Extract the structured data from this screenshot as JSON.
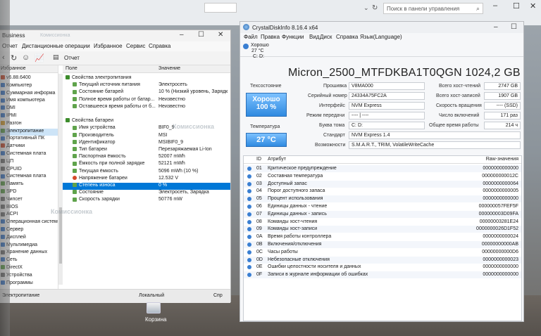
{
  "background_window": {
    "search_placeholder": "Поиск в панели управления"
  },
  "aida": {
    "title": "Business",
    "watermark": "Комиссионка",
    "menu": [
      "Отчет",
      "Дистанционные операции",
      "Избранное",
      "Сервис",
      "Справка"
    ],
    "toolbar_report": "Отчет",
    "left_header": "Избранное",
    "tree": [
      {
        "label": "v6.88.6400",
        "color": "#d04a2a"
      },
      {
        "label": "Компьютер",
        "color": "#3b7bd0"
      },
      {
        "label": "Суммарная информа",
        "color": "#3b7bd0"
      },
      {
        "label": "Имя компьютера",
        "color": "#3b7bd0"
      },
      {
        "label": "DMI",
        "color": "#3b7bd0"
      },
      {
        "label": "IPMI",
        "color": "#3b7bd0"
      },
      {
        "label": "Разгон",
        "color": "#e0a22a"
      },
      {
        "label": "Электропитание",
        "color": "#5fa34b",
        "selected": true
      },
      {
        "label": "Портативный ПК",
        "color": "#3b7bd0"
      },
      {
        "label": "Датчики",
        "color": "#d04a2a"
      },
      {
        "label": "Системная плата",
        "color": "#3b7bd0"
      },
      {
        "label": "ЦП",
        "color": "#777"
      },
      {
        "label": "CPUID",
        "color": "#777"
      },
      {
        "label": "Системная плата",
        "color": "#3b7bd0"
      },
      {
        "label": "Память",
        "color": "#5fa34b"
      },
      {
        "label": "SPD",
        "color": "#5fa34b"
      },
      {
        "label": "Чипсет",
        "color": "#777"
      },
      {
        "label": "BIOS",
        "color": "#777"
      },
      {
        "label": "ACPI",
        "color": "#777"
      },
      {
        "label": "Операционная система",
        "color": "#3b7bd0"
      },
      {
        "label": "Сервер",
        "color": "#3b7bd0"
      },
      {
        "label": "Дисплей",
        "color": "#3b7bd0"
      },
      {
        "label": "Мультимедиа",
        "color": "#3b7bd0"
      },
      {
        "label": "Хранение данных",
        "color": "#777"
      },
      {
        "label": "Сеть",
        "color": "#3b7bd0"
      },
      {
        "label": "DirectX",
        "color": "#5fa34b"
      },
      {
        "label": "Устройства",
        "color": "#777"
      },
      {
        "label": "Программы",
        "color": "#3b7bd0"
      }
    ],
    "col_field": "Поле",
    "col_value": "Значение",
    "rows": [
      {
        "field": "Свойства электропитания",
        "value": "",
        "level": 0
      },
      {
        "field": "Текущий источник питания",
        "value": "Электросеть",
        "level": 1
      },
      {
        "field": "Состояние батарей",
        "value": "10 % (Низкий уровень, Зарядк",
        "level": 1
      },
      {
        "field": "Полное время работы от батар...",
        "value": "Неизвестно",
        "level": 1
      },
      {
        "field": "Оставшееся время работы от б...",
        "value": "Неизвестно",
        "level": 1
      },
      {
        "field": "",
        "value": "",
        "level": 1
      },
      {
        "field": "Свойства батареи",
        "value": "",
        "level": 0
      },
      {
        "field": "Имя устройства",
        "value": "BIF0_9",
        "level": 1
      },
      {
        "field": "Производитель",
        "value": "MSI",
        "level": 1
      },
      {
        "field": "Идентификатор",
        "value": "MSIBIF0_9",
        "level": 1
      },
      {
        "field": "Тип батареи",
        "value": "Перезаряжаемая Li-Ion",
        "level": 1
      },
      {
        "field": "Паспортная ёмкость",
        "value": "52007 mWh",
        "level": 1
      },
      {
        "field": "Ёмкость при полной зарядке",
        "value": "52121 mWh",
        "level": 1
      },
      {
        "field": "Текущая ёмкость",
        "value": "5096 mWh  (10 %)",
        "level": 1
      },
      {
        "field": "Напряжение батареи",
        "value": "12.532 V",
        "level": 1,
        "warn": true
      },
      {
        "field": "Степень износа",
        "value": "0 %",
        "level": 1,
        "selected": true
      },
      {
        "field": "Состояние",
        "value": "Электросеть, Зарядка",
        "level": 1
      },
      {
        "field": "Скорость зарядки",
        "value": "50776 mW",
        "level": 1
      }
    ],
    "status_left": "Электропитание",
    "status_mid": "Локальный",
    "status_right": "Спр"
  },
  "desktop": {
    "trash_label": "Корзина"
  },
  "cdi": {
    "title": "CrystalDiskInfo 8.16.4 x64",
    "menu": [
      "Файл",
      "Правка",
      "Функции",
      "Вид",
      "Диск",
      "Справка",
      "Язык(Language)"
    ],
    "drive_status": "Хорошо",
    "drive_temp": "27 °C",
    "drive_letter": "C: D:",
    "model": "Micron_2500_MTFDKBA1T0QGN 1024,2 GB",
    "tech_state_label": "Техсостояние",
    "health_word": "Хорошо",
    "health_pct": "100 %",
    "temp_label": "Температура",
    "temp_value": "27 °C",
    "fields": {
      "firmware_label": "Прошивка",
      "firmware": "V8MA000",
      "serial_label": "Серийный номер",
      "serial": "24334A75FC2A",
      "interface_label": "Интерфейс",
      "interface": "NVM Express",
      "transfer_label": "Режим передачи",
      "transfer": "---- | ----",
      "letter_label": "Буква тома",
      "letter": "C: D:",
      "standard_label": "Стандарт",
      "standard": "NVM Express 1.4",
      "features_label": "Возможности",
      "features": "S.M.A.R.T., TRIM, VolatileWriteCache",
      "host_reads_label": "Всего хост-чтений",
      "host_reads": "2747 GB",
      "host_writes_label": "Всего хост-записей",
      "host_writes": "1907 GB",
      "rotation_label": "Скорость вращения",
      "rotation": "---- (SSD)",
      "power_on_label": "Число включений",
      "power_on": "171 раз",
      "hours_label": "Общее время работы",
      "hours": "214 ч"
    },
    "smart_hdr": {
      "id": "ID",
      "attr": "Атрибут",
      "raw": "Raw-значения"
    },
    "smart": [
      {
        "id": "01",
        "name": "Критическое предупреждение",
        "raw": "0000000000000"
      },
      {
        "id": "02",
        "name": "Составная температура",
        "raw": "000000000012C"
      },
      {
        "id": "03",
        "name": "Доступный запас",
        "raw": "0000000000064"
      },
      {
        "id": "04",
        "name": "Порог доступного запаса",
        "raw": "0000000000005"
      },
      {
        "id": "05",
        "name": "Процент использования",
        "raw": "0000000000000"
      },
      {
        "id": "06",
        "name": "Единицы данных - чтение",
        "raw": "000000057FEF5F"
      },
      {
        "id": "07",
        "name": "Единицы данных - запись",
        "raw": "000000003D09FA"
      },
      {
        "id": "08",
        "name": "Команды хост-чтения",
        "raw": "00000003281E24"
      },
      {
        "id": "09",
        "name": "Команды хост-записи",
        "raw": "0000000026D1F52"
      },
      {
        "id": "0A",
        "name": "Время работы контроллера",
        "raw": "0000000000024"
      },
      {
        "id": "0B",
        "name": "Включения/отключения",
        "raw": "00000000000AB"
      },
      {
        "id": "0C",
        "name": "Часы работы",
        "raw": "00000000000D6"
      },
      {
        "id": "0D",
        "name": "Небезопасные отключения",
        "raw": "0000000000023"
      },
      {
        "id": "0E",
        "name": "Ошибки целостности носителя и данных",
        "raw": "0000000000000"
      },
      {
        "id": "0F",
        "name": "Записи в журнале информации об ошибках",
        "raw": "0000000000000"
      }
    ]
  }
}
